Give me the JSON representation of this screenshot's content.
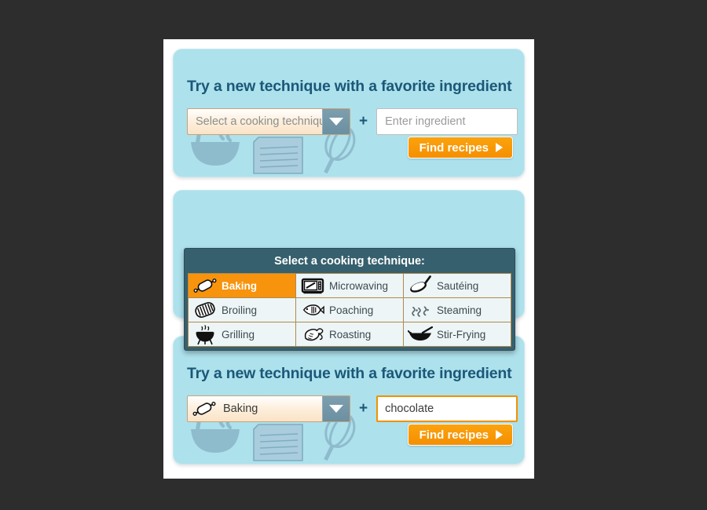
{
  "colors": {
    "page_background": "#2d2d2d",
    "card_background": "#ffffff",
    "panel_background": "#ade1ec",
    "heading_text": "#1b5878",
    "accent_orange": "#f7930d",
    "dropdown_header": "#37606e",
    "select_arrow": "#6b90a1",
    "deco_art": "#8fbccd"
  },
  "panels": {
    "empty_state": {
      "title": "Try a new technique with a favorite ingredient",
      "select": {
        "label": "Select a cooking technique",
        "icon": "none",
        "filled": false,
        "arrow_icon": "chevron-down-icon"
      },
      "plus": "+",
      "ingredient": {
        "value": "",
        "placeholder": "Enter ingredient",
        "focused": false
      },
      "submit": {
        "label": "Find recipes",
        "arrow_icon": "arrow-right-icon"
      }
    },
    "filled_state": {
      "title": "Try a new technique with a favorite ingredient",
      "select": {
        "label": "Baking",
        "icon": "rolling-pin-icon",
        "filled": true,
        "arrow_icon": "chevron-down-icon"
      },
      "plus": "+",
      "ingredient": {
        "value": "chocolate",
        "placeholder": "Enter ingredient",
        "focused": true
      },
      "submit": {
        "label": "Find recipes",
        "arrow_icon": "arrow-right-icon"
      }
    }
  },
  "dropdown": {
    "header": "Select a cooking technique:",
    "selected": "Baking",
    "options": [
      {
        "label": "Baking",
        "icon": "rolling-pin-icon",
        "selected": true
      },
      {
        "label": "Microwaving",
        "icon": "microwave-icon",
        "selected": false
      },
      {
        "label": "Sautéing",
        "icon": "saute-pan-icon",
        "selected": false
      },
      {
        "label": "Broiling",
        "icon": "broiler-pan-icon",
        "selected": false
      },
      {
        "label": "Poaching",
        "icon": "fish-icon",
        "selected": false
      },
      {
        "label": "Steaming",
        "icon": "steam-wisps-icon",
        "selected": false
      },
      {
        "label": "Grilling",
        "icon": "bbq-grill-icon",
        "selected": false
      },
      {
        "label": "Roasting",
        "icon": "roast-poultry-icon",
        "selected": false
      },
      {
        "label": "Stir-Frying",
        "icon": "wok-icon",
        "selected": false
      }
    ]
  },
  "decoration": {
    "items": [
      "mixing-bowl-icon",
      "recipe-card-icon",
      "whisk-icon"
    ]
  }
}
